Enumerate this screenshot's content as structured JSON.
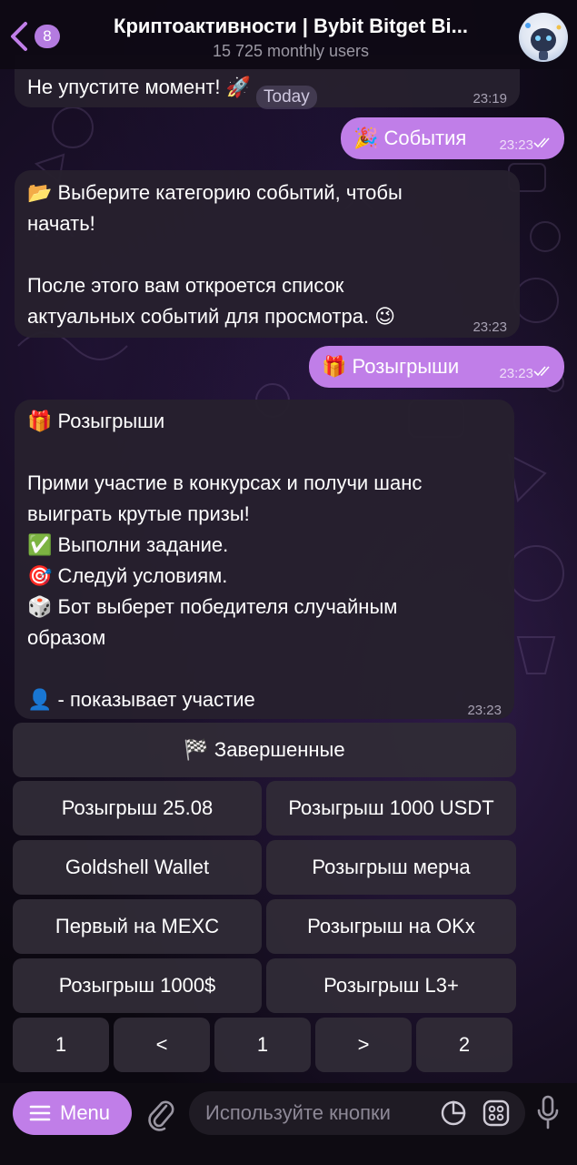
{
  "header": {
    "back_count": "8",
    "title": "Криптоактивности | Bybit Bitget Bi...",
    "subtitle": "15 725 monthly users"
  },
  "date_chip": "Today",
  "messages": [
    {
      "text": "Не упустите момент! 🚀",
      "time": "23:19"
    },
    {
      "text": "🎉 События",
      "time": "23:23"
    },
    {
      "lines": [
        "📂 Выберите категорию событий, чтобы",
        "начать!",
        "",
        "После этого вам откроется список",
        "актуальных событий для просмотра. 😉"
      ],
      "time": "23:23"
    },
    {
      "text": "🎁 Розыгрыши",
      "time": "23:23"
    },
    {
      "lines": [
        "🎁 Розыгрыши",
        "",
        "Прими участие в конкурсах и получи шанс",
        "выиграть крутые призы!",
        "✅ Выполни задание.",
        "🎯 Следуй условиям.",
        "🎲 Бот выберет победителя случайным",
        "образом",
        "",
        "👤 - показывает участие"
      ],
      "time": "23:23"
    }
  ],
  "keyboard": {
    "completed": "🏁 Завершенные",
    "rows": [
      [
        "Розыгрыш 25.08",
        "Розыгрыш 1000 USDT"
      ],
      [
        "Goldshell Wallet",
        "Розыгрыш мерча"
      ],
      [
        "Первый на MEXC",
        "Розыгрыш на OKx"
      ],
      [
        "Розыгрыш 1000$",
        "Розыгрыш L3+"
      ]
    ],
    "pagination": [
      "1",
      "<",
      "1",
      ">",
      "2"
    ]
  },
  "bottom": {
    "menu_label": "Menu",
    "input_placeholder": "Используйте кнопки"
  },
  "colors": {
    "accent": "#c07ee8",
    "badge": "#b47be0",
    "incoming_bubble": "#26202e",
    "keyboard_button": "#302b36"
  },
  "icons": [
    "back-chevron-icon",
    "paperclip-icon",
    "sticker-icon",
    "bot-keyboard-icon",
    "microphone-icon",
    "menu-lines-icon",
    "double-check-icon"
  ]
}
